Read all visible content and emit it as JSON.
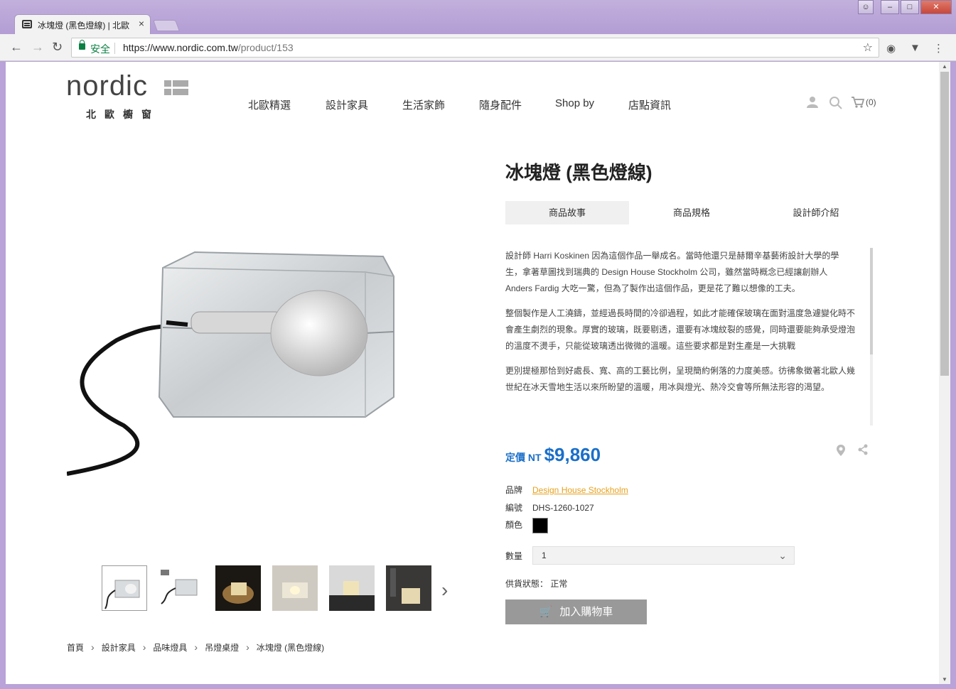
{
  "browser": {
    "tab_title": "冰塊燈 (黑色燈線) | 北歐",
    "tab_close": "×",
    "secure_label": "安全",
    "url_host": "https://www.nordic.com.tw",
    "url_path": "/product/153"
  },
  "site": {
    "logo_text": "nordic",
    "logo_sub": "北歐櫥窗",
    "nav": [
      "北歐精選",
      "設計家具",
      "生活家飾",
      "隨身配件",
      "Shop by",
      "店點資訊"
    ],
    "cart_count": "(0)"
  },
  "product": {
    "title": "冰塊燈 (黑色燈線)",
    "tabs": [
      "商品故事",
      "商品規格",
      "設計師介紹"
    ],
    "active_tab": 0,
    "story": [
      "設計師 Harri Koskinen 因為這個作品一舉成名。當時他還只是赫爾辛基藝術設計大學的學生，拿著草圖找到瑞典的 Design House Stockholm 公司，雖然當時概念已經讓創辦人 Anders Fardig 大吃一驚，但為了製作出這個作品，更是花了難以想像的工夫。",
      "整個製作是人工澆鑄，並經過長時間的冷卻過程，如此才能確保玻璃在面對溫度急遽變化時不會產生劇烈的現象。厚實的玻璃，既要剔透，還要有冰塊紋裂的感覺，同時還要能夠承受燈泡的溫度不燙手，只能從玻璃透出微微的溫暖。這些要求都是對生產是一大挑戰",
      "更別提極那恰到好處長、寬、高的工藝比例，呈現簡約俐落的力度美感。彷彿象徵著北歐人幾世紀在冰天雪地生活以來所盼望的溫暖，用冰與燈光、熱冷交會等所無法形容的渴望。"
    ],
    "price_label": "定價 NT",
    "price_value": "$9,860",
    "brand_label": "品牌",
    "brand_value": "Design House Stockholm",
    "sku_label": "編號",
    "sku_value": "DHS-1260-1027",
    "color_label": "顏色",
    "color_value": "#000000",
    "qty_label": "數量",
    "qty_value": "1",
    "stock_label": "供貨狀態：",
    "stock_value": "正常",
    "add_to_cart": "加入購物車"
  },
  "breadcrumb": [
    "首頁",
    "設計家具",
    "品味燈具",
    "吊燈桌燈",
    "冰塊燈 (黑色燈線)"
  ],
  "colors": {
    "accent_blue": "#1a6fc9",
    "brand_link": "#e6a11e",
    "secure_green": "#0b8043",
    "button_gray": "#999999"
  }
}
